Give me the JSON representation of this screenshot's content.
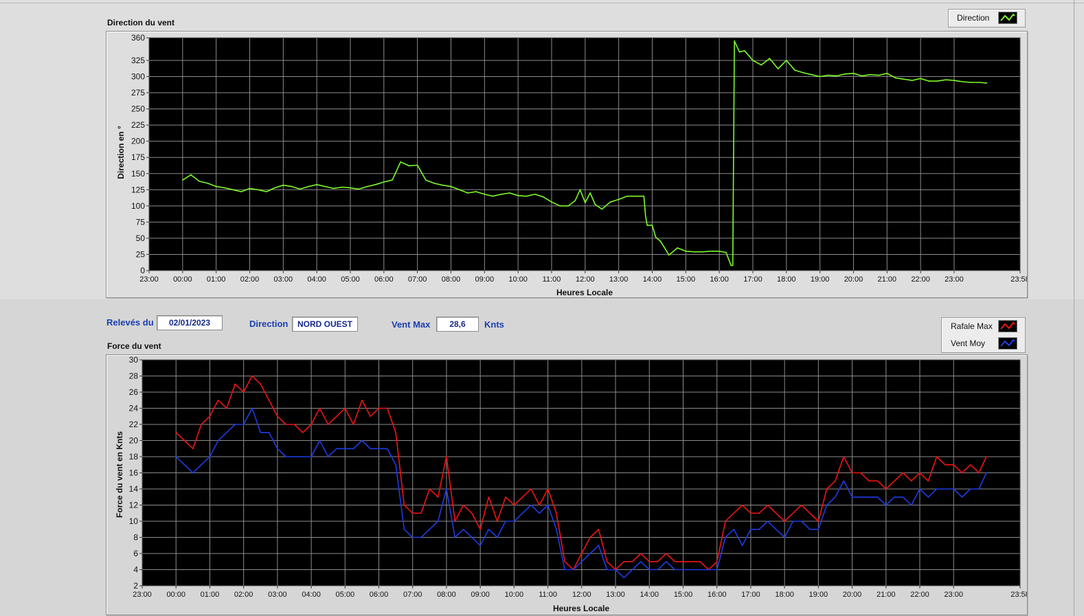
{
  "colors": {
    "plot_bg": "#000000",
    "grid": "#8c8c8c",
    "direction_line": "#7CFC2A",
    "gust_line": "#F01414",
    "mean_line": "#1E3CE6",
    "label_blue": "#1a3fb0"
  },
  "header": {
    "releves_label": "Relevés du",
    "date_value": "02/01/2023",
    "direction_label": "Direction",
    "direction_value": "NORD OUEST",
    "ventmax_label": "Vent Max",
    "ventmax_value": "28,6",
    "ventmax_unit": "Knts"
  },
  "chart_data": [
    {
      "type": "line",
      "title": "Direction du vent",
      "xlabel": "Heures Locale",
      "ylabel": "Direction en °",
      "x_ticks": [
        "23:00",
        "00:00",
        "01:00",
        "02:00",
        "03:00",
        "04:00",
        "05:00",
        "06:00",
        "07:00",
        "08:00",
        "09:00",
        "10:00",
        "11:00",
        "12:00",
        "13:00",
        "14:00",
        "15:00",
        "16:00",
        "17:00",
        "18:00",
        "19:00",
        "20:00",
        "21:00",
        "22:00",
        "23:00",
        "23:58"
      ],
      "xlim": [
        -1,
        24.967
      ],
      "y_ticks": [
        0,
        25,
        50,
        75,
        100,
        125,
        150,
        175,
        200,
        225,
        250,
        275,
        300,
        325,
        360
      ],
      "ylim": [
        0,
        360
      ],
      "grid": true,
      "legend_position": "top-right",
      "series": [
        {
          "name": "Direction",
          "color": "#7CFC2A",
          "x": [
            0,
            0.25,
            0.5,
            0.75,
            1,
            1.25,
            1.5,
            1.75,
            2,
            2.25,
            2.5,
            2.75,
            3,
            3.25,
            3.5,
            3.75,
            4,
            4.25,
            4.5,
            4.75,
            5,
            5.25,
            5.5,
            5.75,
            6,
            6.25,
            6.5,
            6.75,
            7,
            7.25,
            7.5,
            7.75,
            8,
            8.25,
            8.5,
            8.75,
            9,
            9.25,
            9.5,
            9.75,
            10,
            10.25,
            10.5,
            10.75,
            11,
            11.25,
            11.5,
            11.7,
            11.85,
            12,
            12.15,
            12.3,
            12.5,
            12.75,
            13,
            13.25,
            13.5,
            13.75,
            13.8,
            13.85,
            14,
            14.1,
            14.25,
            14.5,
            14.75,
            15,
            15.25,
            15.5,
            15.75,
            16,
            16.2,
            16.35,
            16.4,
            16.45,
            16.6,
            16.75,
            17,
            17.25,
            17.5,
            17.75,
            18,
            18.25,
            18.5,
            18.75,
            19,
            19.25,
            19.5,
            19.75,
            20,
            20.25,
            20.5,
            20.75,
            21,
            21.25,
            21.5,
            21.75,
            22,
            22.25,
            22.5,
            22.75,
            23,
            23.25,
            23.5,
            23.75,
            23.97
          ],
          "y": [
            140,
            148,
            138,
            135,
            130,
            128,
            125,
            122,
            127,
            125,
            122,
            128,
            132,
            130,
            126,
            130,
            133,
            130,
            127,
            129,
            128,
            126,
            130,
            133,
            137,
            140,
            168,
            162,
            163,
            140,
            135,
            132,
            130,
            125,
            120,
            122,
            118,
            115,
            118,
            120,
            116,
            115,
            118,
            114,
            106,
            100,
            100,
            108,
            125,
            105,
            120,
            102,
            95,
            106,
            110,
            115,
            115,
            115,
            85,
            70,
            70,
            52,
            45,
            24,
            35,
            30,
            29,
            29,
            30,
            30,
            28,
            8,
            8,
            355,
            338,
            340,
            325,
            318,
            328,
            312,
            325,
            310,
            306,
            303,
            300,
            302,
            301,
            304,
            305,
            301,
            303,
            302,
            305,
            298,
            296,
            294,
            297,
            293,
            293,
            295,
            294,
            292,
            291,
            291,
            290
          ]
        }
      ]
    },
    {
      "type": "line",
      "title": "Force du vent",
      "xlabel": "Heures Locale",
      "ylabel": "Force du vent en Knts",
      "x_ticks": [
        "23:00",
        "00:00",
        "01:00",
        "02:00",
        "03:00",
        "04:00",
        "05:00",
        "06:00",
        "07:00",
        "08:00",
        "09:00",
        "10:00",
        "11:00",
        "12:00",
        "13:00",
        "14:00",
        "15:00",
        "16:00",
        "17:00",
        "18:00",
        "19:00",
        "20:00",
        "21:00",
        "22:00",
        "23:00",
        "23:58"
      ],
      "xlim": [
        -1,
        24.967
      ],
      "y_ticks": [
        2,
        4,
        6,
        8,
        10,
        12,
        14,
        16,
        18,
        20,
        22,
        24,
        26,
        28,
        30
      ],
      "ylim": [
        2,
        30
      ],
      "grid": true,
      "legend_position": "top-right",
      "series": [
        {
          "name": "Rafale Max",
          "color": "#F01414",
          "x": [
            0,
            0.25,
            0.5,
            0.75,
            1,
            1.25,
            1.5,
            1.75,
            2,
            2.25,
            2.5,
            2.75,
            3,
            3.25,
            3.5,
            3.75,
            4,
            4.25,
            4.5,
            4.75,
            5,
            5.25,
            5.5,
            5.75,
            6,
            6.25,
            6.5,
            6.75,
            7,
            7.25,
            7.5,
            7.75,
            8,
            8.25,
            8.5,
            8.75,
            9,
            9.25,
            9.5,
            9.75,
            10,
            10.25,
            10.5,
            10.75,
            11,
            11.25,
            11.5,
            11.75,
            12,
            12.25,
            12.5,
            12.75,
            13,
            13.25,
            13.5,
            13.75,
            14,
            14.25,
            14.5,
            14.75,
            15,
            15.25,
            15.5,
            15.75,
            16,
            16.25,
            16.5,
            16.75,
            17,
            17.25,
            17.5,
            17.75,
            18,
            18.25,
            18.5,
            18.75,
            19,
            19.25,
            19.5,
            19.75,
            20,
            20.25,
            20.5,
            20.75,
            21,
            21.25,
            21.5,
            21.75,
            22,
            22.25,
            22.5,
            22.75,
            23,
            23.25,
            23.5,
            23.75,
            23.97
          ],
          "y": [
            21,
            20,
            19,
            22,
            23,
            25,
            24,
            27,
            26,
            28,
            27,
            25,
            23,
            22,
            22,
            21,
            22,
            24,
            22,
            23,
            24,
            22,
            25,
            23,
            24,
            24,
            21,
            12,
            11,
            11,
            14,
            13,
            18,
            10,
            12,
            11,
            9,
            13,
            10,
            13,
            12,
            13,
            14,
            12,
            14,
            11,
            5,
            4,
            6,
            8,
            9,
            5,
            4,
            5,
            5,
            6,
            5,
            5,
            6,
            5,
            5,
            5,
            5,
            4,
            5,
            10,
            11,
            12,
            11,
            11,
            12,
            11,
            10,
            11,
            12,
            11,
            10,
            14,
            15,
            18,
            16,
            16,
            15,
            15,
            14,
            15,
            16,
            15,
            16,
            15,
            18,
            17,
            17,
            16,
            17,
            16,
            18
          ]
        },
        {
          "name": "Vent Moy",
          "color": "#1E3CE6",
          "x": [
            0,
            0.25,
            0.5,
            0.75,
            1,
            1.25,
            1.5,
            1.75,
            2,
            2.25,
            2.5,
            2.75,
            3,
            3.25,
            3.5,
            3.75,
            4,
            4.25,
            4.5,
            4.75,
            5,
            5.25,
            5.5,
            5.75,
            6,
            6.25,
            6.5,
            6.75,
            7,
            7.25,
            7.5,
            7.75,
            8,
            8.25,
            8.5,
            8.75,
            9,
            9.25,
            9.5,
            9.75,
            10,
            10.25,
            10.5,
            10.75,
            11,
            11.25,
            11.5,
            11.75,
            12,
            12.25,
            12.5,
            12.75,
            13,
            13.25,
            13.5,
            13.75,
            14,
            14.25,
            14.5,
            14.75,
            15,
            15.25,
            15.5,
            15.75,
            16,
            16.25,
            16.5,
            16.75,
            17,
            17.25,
            17.5,
            17.75,
            18,
            18.25,
            18.5,
            18.75,
            19,
            19.25,
            19.5,
            19.75,
            20,
            20.25,
            20.5,
            20.75,
            21,
            21.25,
            21.5,
            21.75,
            22,
            22.25,
            22.5,
            22.75,
            23,
            23.25,
            23.5,
            23.75,
            23.97
          ],
          "y": [
            18,
            17,
            16,
            17,
            18,
            20,
            21,
            22,
            22,
            24,
            21,
            21,
            19,
            18,
            18,
            18,
            18,
            20,
            18,
            19,
            19,
            19,
            20,
            19,
            19,
            19,
            17,
            9,
            8,
            8,
            9,
            10,
            14,
            8,
            9,
            8,
            7,
            9,
            8,
            10,
            10,
            11,
            12,
            11,
            12,
            9,
            4,
            4,
            5,
            6,
            7,
            4,
            4,
            3,
            4,
            5,
            4,
            4,
            5,
            4,
            4,
            4,
            4,
            4,
            4,
            8,
            9,
            7,
            9,
            9,
            10,
            9,
            8,
            10,
            10,
            9,
            9,
            12,
            13,
            15,
            13,
            13,
            13,
            13,
            12,
            13,
            13,
            12,
            14,
            13,
            14,
            14,
            14,
            13,
            14,
            14,
            16
          ]
        }
      ]
    }
  ]
}
